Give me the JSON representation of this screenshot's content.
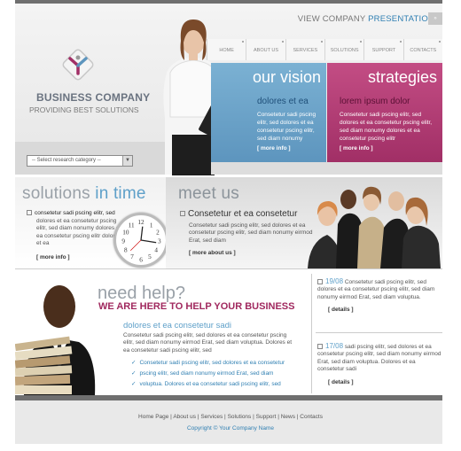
{
  "header": {
    "view_prefix": "VIEW COMPANY",
    "view_highlight": "PRESENTATION",
    "nav": [
      "HOME",
      "ABOUT US",
      "SERVICES",
      "SOLUTIONS",
      "SUPPORT",
      "CONTACTS"
    ],
    "brand": "BUSINESS COMPANY",
    "tagline": "PROVIDING BEST SOLUTIONS",
    "select_value": "-- Select research category --"
  },
  "vision": {
    "title": "our vision",
    "subtitle": "dolores et ea",
    "text": "Consetetur sadi pscing elitr, sed dolores et ea consetetur pscing elitr, sed diam nonumy",
    "more": "[ more info ]"
  },
  "strategies": {
    "title": "strategies",
    "subtitle": "lorem ipsum dolor",
    "text": "Consetetur sadi pscing elitr, sed dolores et ea consetetur pscing elitr, sed diam nonumy dolores et ea consetetur pscing elitr",
    "more": "[ more info ]"
  },
  "solutions": {
    "title_a": "solutions ",
    "title_b": "in time",
    "lead": "consetetur sadi pscing elitr, sed",
    "text": "dolores et ea consetetur pscing elitr, sed diam nonumy dolores et ea consetetur pscing elitr dolores et ea",
    "more": "[ more info ]"
  },
  "meet": {
    "title": "meet us",
    "lead": "Consetetur et ea consetetur",
    "text": "Consetetur sadi pscing elitr, sed dolores et ea consetetur pscing elitr, sed diam nonumy eirmod Erat, sed diam",
    "more": "[ more about us ]"
  },
  "help": {
    "title": "need help?",
    "subtitle": "WE ARE HERE TO HELP YOUR BUSINESS",
    "heading": "dolores et ea consetetur sadi",
    "text": "Consetetur sadi pscing elitr, sed dolores et ea consetetur pscing elitr, sed diam nonumy eirmod Erat, sed diam voluptua. Dolores et ea consetetur sadi pscing elitr, sed",
    "checks": [
      "Consetetur sadi pscing elitr, sed dolores et ea consetetur",
      "pscing elitr, sed diam nonumy eirmod Erat, sed diam",
      "voluptua. Dolores et ea consetetur sadi pscing elitr, sed"
    ]
  },
  "news": [
    {
      "date": "19/08",
      "text": "Consetetur sadi pscing elitr, sed dolores et ea consetetur pscing elitr, sed diam nonumy eirmod Erat, sed diam voluptua.",
      "more": "[ details ]"
    },
    {
      "date": "17/08",
      "text": "sadi pscing elitr, sed dolores et ea consetetur pscing elitr, sed diam nonumy eirmod Erat, sed diam voluptua. Dolores et ea consetetur sadi",
      "more": "[ details ]"
    }
  ],
  "footer": {
    "links": [
      "Home Page",
      "About us",
      "Services",
      "Solutions",
      "Support",
      "News",
      "Contacts"
    ],
    "copyright": "Copyright © Your Company Name"
  }
}
